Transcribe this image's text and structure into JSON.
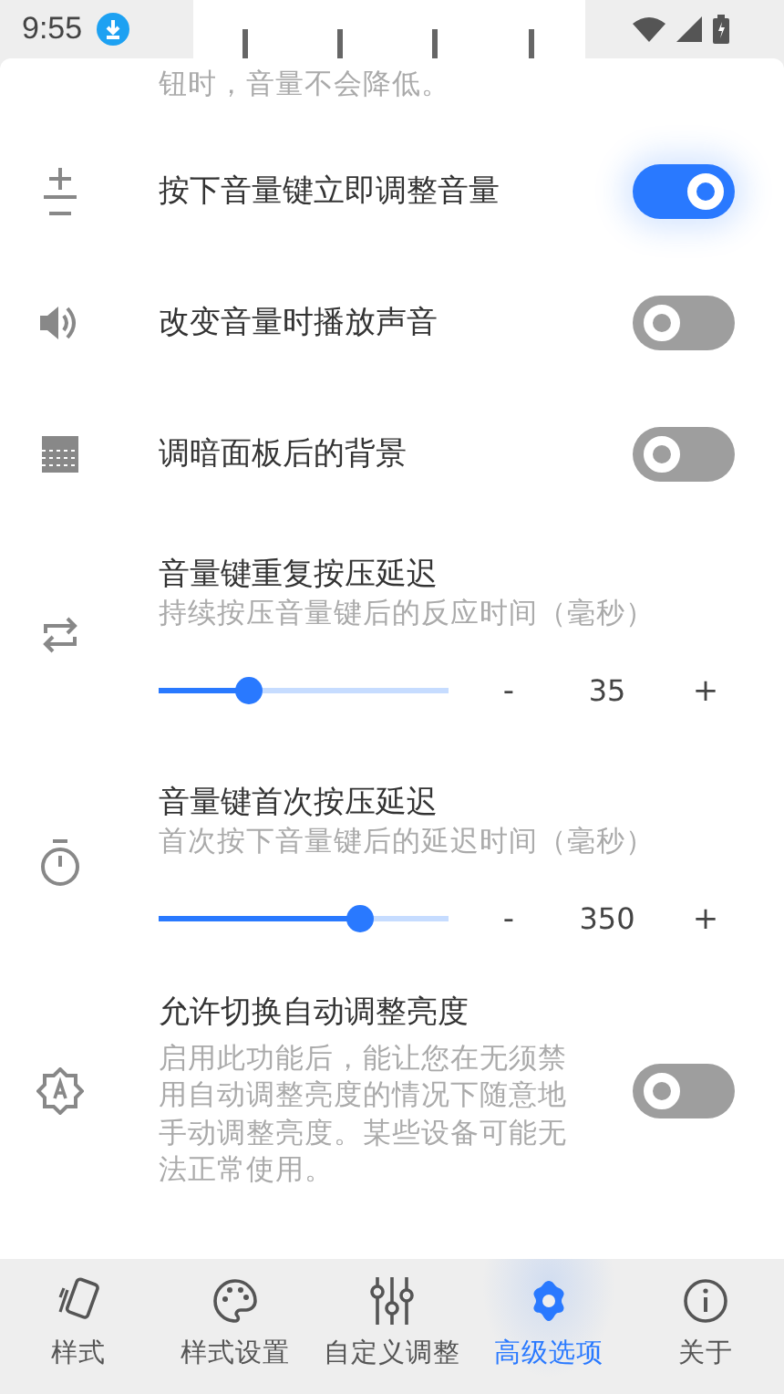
{
  "status_bar": {
    "time": "9:55"
  },
  "settings": [
    {
      "kind": "note",
      "description": "钮时，音量不会降低。"
    },
    {
      "kind": "toggle",
      "title": "按下音量键立即调整音量",
      "on": true
    },
    {
      "kind": "toggle",
      "title": "改变音量时播放声音",
      "on": false
    },
    {
      "kind": "toggle",
      "title": "调暗面板后的背景",
      "on": false
    },
    {
      "kind": "slider",
      "title": "音量键重复按压延迟",
      "description": "持续按压音量键后的反应时间（毫秒）",
      "level": 0.31,
      "minus": "-",
      "value": "35",
      "plus": "+"
    },
    {
      "kind": "slider",
      "title": "音量键首次按压延迟",
      "description": "首次按下音量键后的延迟时间（毫秒）",
      "level": 0.69,
      "minus": "-",
      "value": "350",
      "plus": "+"
    },
    {
      "kind": "toggle",
      "title": "允许切换自动调整亮度",
      "description": "启用此功能后，能让您在无须禁用自动调整亮度的情况下随意地手动调整亮度。某些设备可能无法正常使用。",
      "on": false
    }
  ],
  "nav": [
    {
      "label": "样式",
      "selected": false
    },
    {
      "label": "样式设置",
      "selected": false
    },
    {
      "label": "自定义调整",
      "selected": false
    },
    {
      "label": "高级选项",
      "selected": true
    },
    {
      "label": "关于",
      "selected": false
    }
  ]
}
